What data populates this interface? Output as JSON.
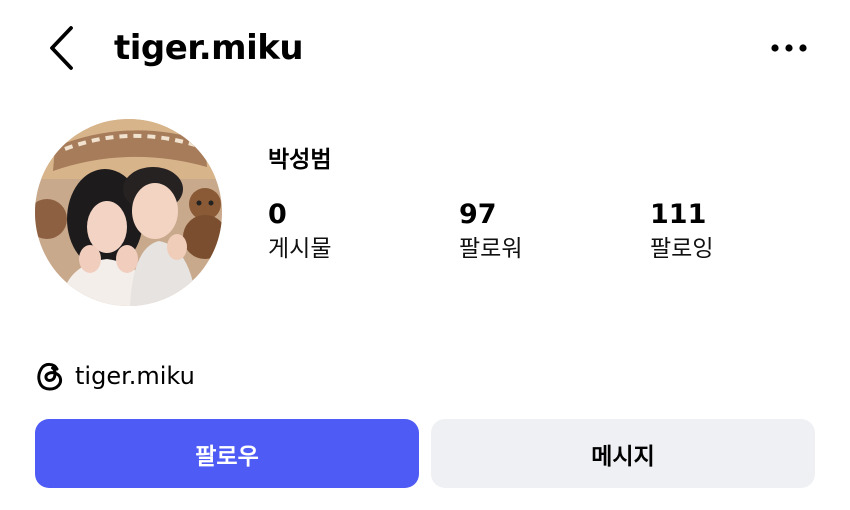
{
  "header": {
    "username": "tiger.miku"
  },
  "profile": {
    "display_name": "박성범",
    "stats": [
      {
        "value": "0",
        "label": "게시물"
      },
      {
        "value": "97",
        "label": "팔로워"
      },
      {
        "value": "111",
        "label": "팔로잉"
      }
    ],
    "threads_handle": "tiger.miku"
  },
  "actions": {
    "follow_label": "팔로우",
    "message_label": "메시지"
  },
  "icons": {
    "back": "chevron-left-icon",
    "more": "more-horizontal-icon",
    "threads": "threads-icon"
  },
  "colors": {
    "follow_button": "#4f5bf5",
    "message_button": "#eff0f3"
  }
}
